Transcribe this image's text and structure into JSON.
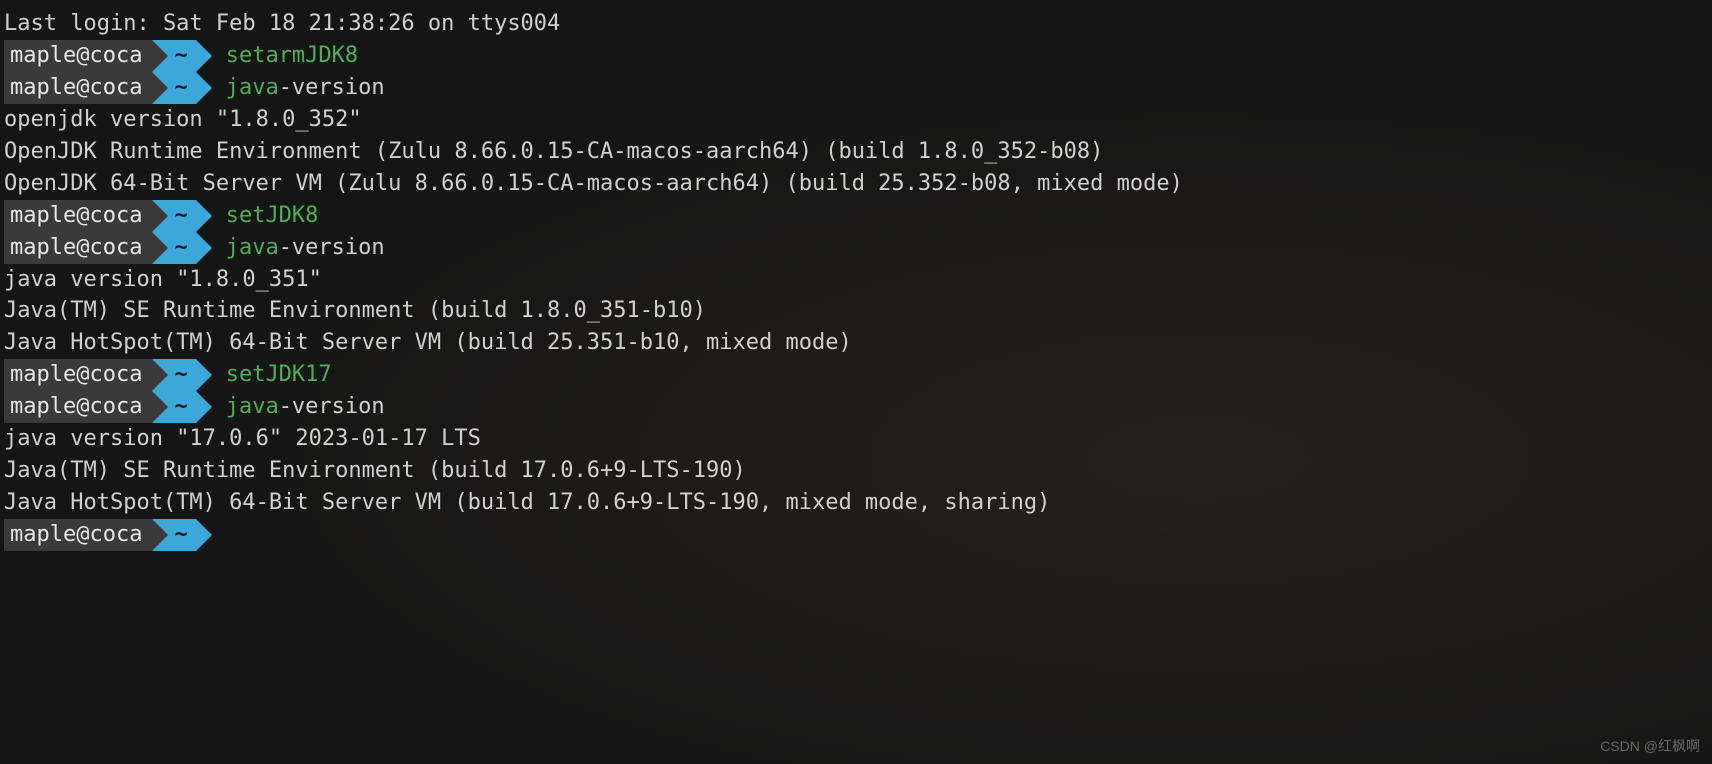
{
  "login_line": "Last login: Sat Feb 18 21:38:26 on ttys004",
  "user_host": "maple@coca",
  "path_seg": "~",
  "blocks": [
    {
      "cmd": "setarmJDK8",
      "arg": "",
      "output": []
    },
    {
      "cmd": "java",
      "arg": " -version",
      "output": [
        "openjdk version \"1.8.0_352\"",
        "OpenJDK Runtime Environment (Zulu 8.66.0.15-CA-macos-aarch64) (build 1.8.0_352-b08)",
        "OpenJDK 64-Bit Server VM (Zulu 8.66.0.15-CA-macos-aarch64) (build 25.352-b08, mixed mode)"
      ]
    },
    {
      "cmd": "setJDK8",
      "arg": "",
      "output": []
    },
    {
      "cmd": "java",
      "arg": " -version",
      "output": [
        "java version \"1.8.0_351\"",
        "Java(TM) SE Runtime Environment (build 1.8.0_351-b10)",
        "Java HotSpot(TM) 64-Bit Server VM (build 25.351-b10, mixed mode)"
      ]
    },
    {
      "cmd": "setJDK17",
      "arg": "",
      "output": []
    },
    {
      "cmd": "java",
      "arg": " -version",
      "output": [
        "java version \"17.0.6\" 2023-01-17 LTS",
        "Java(TM) SE Runtime Environment (build 17.0.6+9-LTS-190)",
        "Java HotSpot(TM) 64-Bit Server VM (build 17.0.6+9-LTS-190, mixed mode, sharing)"
      ]
    }
  ],
  "watermark": "CSDN @红枫啊"
}
